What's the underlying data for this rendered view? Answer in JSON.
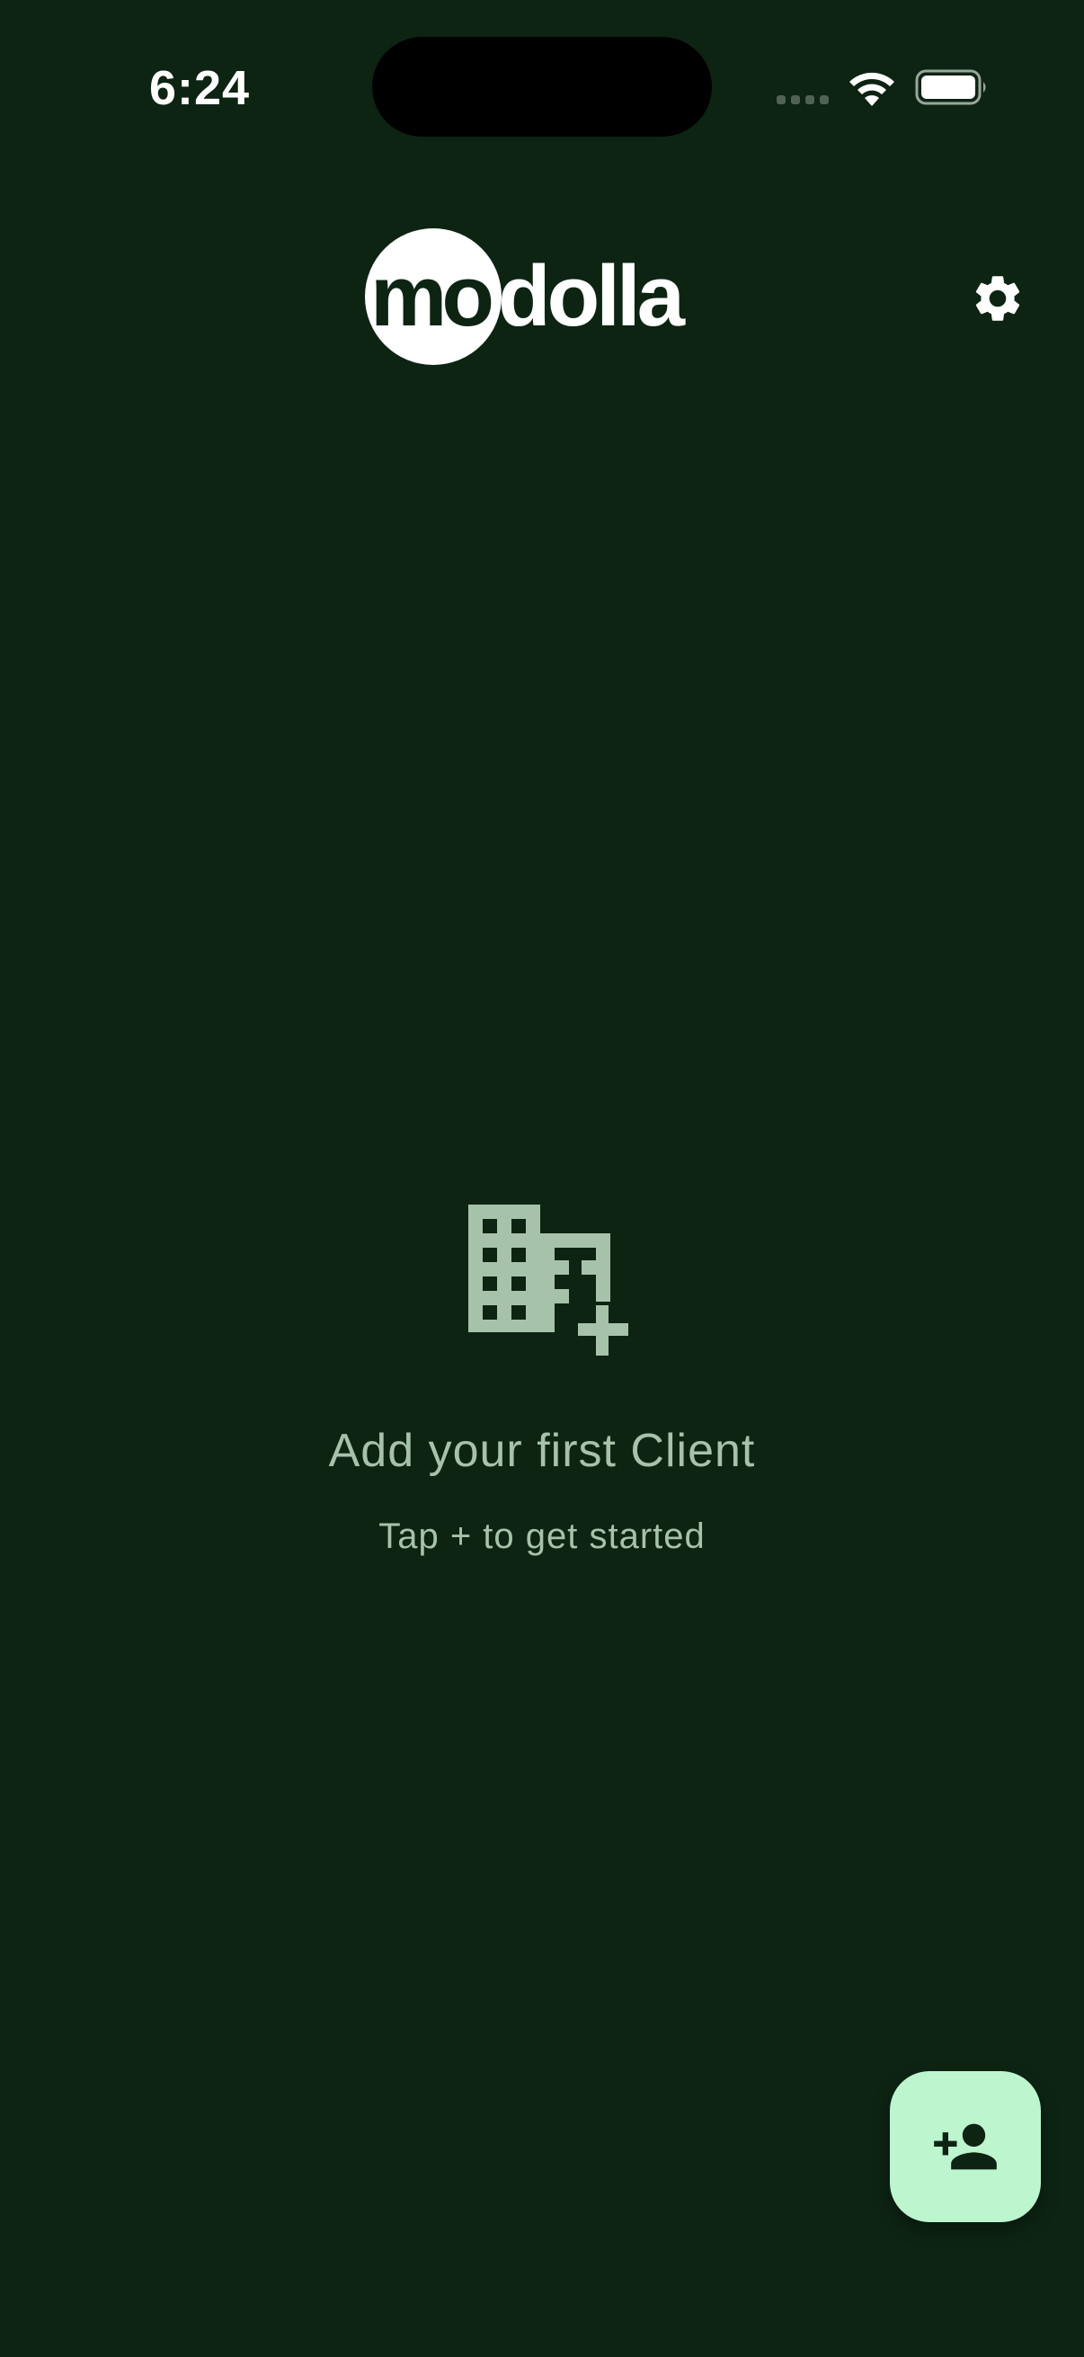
{
  "status_bar": {
    "time": "6:24",
    "icons": [
      "cellular-signal-icon",
      "wifi-icon",
      "battery-icon"
    ]
  },
  "header": {
    "logo_text": "modolla",
    "settings_icon": "gear-icon"
  },
  "empty_state": {
    "icon": "add-business-icon",
    "title": "Add your first Client",
    "subtitle": "Tap + to get started"
  },
  "fab": {
    "icon": "person-add-icon"
  },
  "colors": {
    "background": "#0d2413",
    "muted_text": "#a7c2ab",
    "fab_background": "#bdf5cf",
    "fab_icon": "#0d2413",
    "white": "#ffffff"
  }
}
